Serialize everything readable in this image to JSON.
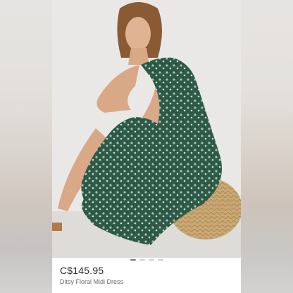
{
  "product": {
    "price": "C$145.95",
    "title": "Ditsy Floral Midi Dress",
    "image_count": 4,
    "active_image": 1
  },
  "colors": {
    "dress": "#2f5a48",
    "pouf": "#c9a873",
    "background": "#e9e8e6"
  },
  "icons": {
    "pagination": "dot-indicator"
  }
}
